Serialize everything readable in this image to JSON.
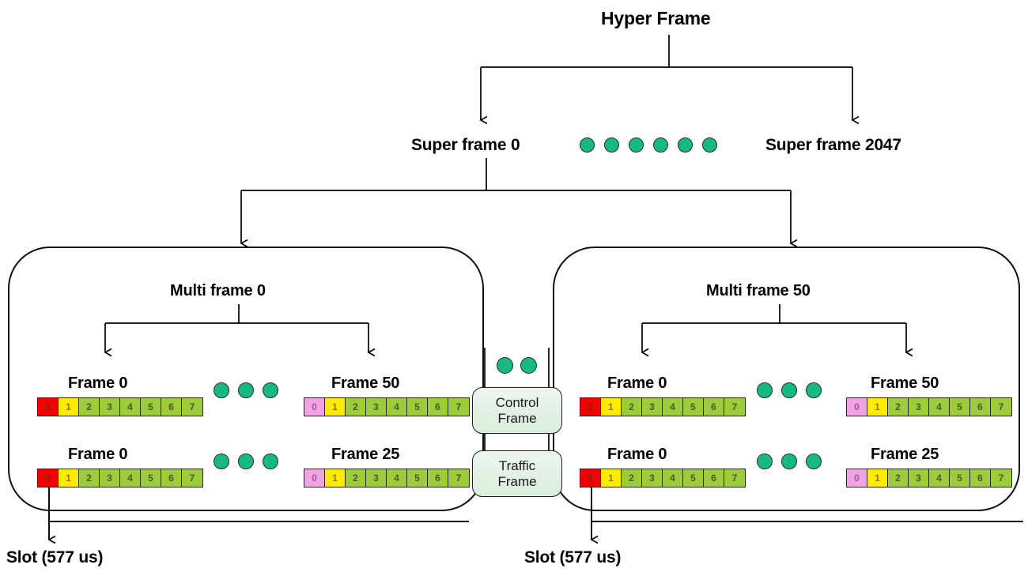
{
  "diagram": {
    "title": "Hyper Frame",
    "hierarchy_levels": [
      "Hyper Frame",
      "Super frame",
      "Multi frame",
      "Frame",
      "Slot"
    ]
  },
  "top": {
    "hyper_frame_label": "Hyper Frame",
    "super_frame_left_label": "Super frame 0",
    "super_frame_right_label": "Super frame 2047",
    "super_frame_ellipsis_dots": 6
  },
  "left_group": {
    "multi_frame_label": "Multi frame 0",
    "row1": {
      "first_frame_label": "Frame 0",
      "last_frame_label": "Frame 50",
      "ellipsis_dots": 3,
      "first_strip": {
        "slots": [
          "0",
          "1",
          "2",
          "3",
          "4",
          "5",
          "6",
          "7"
        ],
        "colors": [
          "red",
          "yellow",
          "green",
          "green",
          "green",
          "green",
          "green",
          "green"
        ]
      },
      "last_strip": {
        "slots": [
          "0",
          "1",
          "2",
          "3",
          "4",
          "5",
          "6",
          "7"
        ],
        "colors": [
          "pink",
          "yellow",
          "green",
          "green",
          "green",
          "green",
          "green",
          "green"
        ]
      }
    },
    "row2": {
      "first_frame_label": "Frame 0",
      "last_frame_label": "Frame 25",
      "ellipsis_dots": 3,
      "first_strip": {
        "slots": [
          "0",
          "1",
          "2",
          "3",
          "4",
          "5",
          "6",
          "7"
        ],
        "colors": [
          "red",
          "yellow",
          "green",
          "green",
          "green",
          "green",
          "green",
          "green"
        ]
      },
      "last_strip": {
        "slots": [
          "0",
          "1",
          "2",
          "3",
          "4",
          "5",
          "6",
          "7"
        ],
        "colors": [
          "pink",
          "yellow",
          "green",
          "green",
          "green",
          "green",
          "green",
          "green"
        ]
      }
    },
    "slot_label": "Slot (577 us)"
  },
  "right_group": {
    "multi_frame_label": "Multi frame 50",
    "row1": {
      "first_frame_label": "Frame 0",
      "last_frame_label": "Frame 50",
      "ellipsis_dots": 3,
      "first_strip": {
        "slots": [
          "0",
          "1",
          "2",
          "3",
          "4",
          "5",
          "6",
          "7"
        ],
        "colors": [
          "red",
          "yellow",
          "green",
          "green",
          "green",
          "green",
          "green",
          "green"
        ]
      },
      "last_strip": {
        "slots": [
          "0",
          "1",
          "2",
          "3",
          "4",
          "5",
          "6",
          "7"
        ],
        "colors": [
          "pink",
          "yellow",
          "green",
          "green",
          "green",
          "green",
          "green",
          "green"
        ]
      }
    },
    "row2": {
      "first_frame_label": "Frame 0",
      "last_frame_label": "Frame 25",
      "ellipsis_dots": 3,
      "first_strip": {
        "slots": [
          "0",
          "1",
          "2",
          "3",
          "4",
          "5",
          "6",
          "7"
        ],
        "colors": [
          "red",
          "yellow",
          "green",
          "green",
          "green",
          "green",
          "green",
          "green"
        ]
      },
      "last_strip": {
        "slots": [
          "0",
          "1",
          "2",
          "3",
          "4",
          "5",
          "6",
          "7"
        ],
        "colors": [
          "pink",
          "yellow",
          "green",
          "green",
          "green",
          "green",
          "green",
          "green"
        ]
      }
    },
    "slot_label": "Slot (577 us)"
  },
  "center": {
    "control_frame_line1": "Control",
    "control_frame_line2": "Frame",
    "traffic_frame_line1": "Traffic",
    "traffic_frame_line2": "Frame",
    "ellipsis_dots": 2
  },
  "colors": {
    "dot_green": "#16b97f",
    "slot_red": "#f40000",
    "slot_yellow": "#ffeb00",
    "slot_green": "#9ccb3b",
    "slot_pink": "#f2a3e6",
    "box_fill": "#e6f2e7",
    "line": "#000000"
  }
}
